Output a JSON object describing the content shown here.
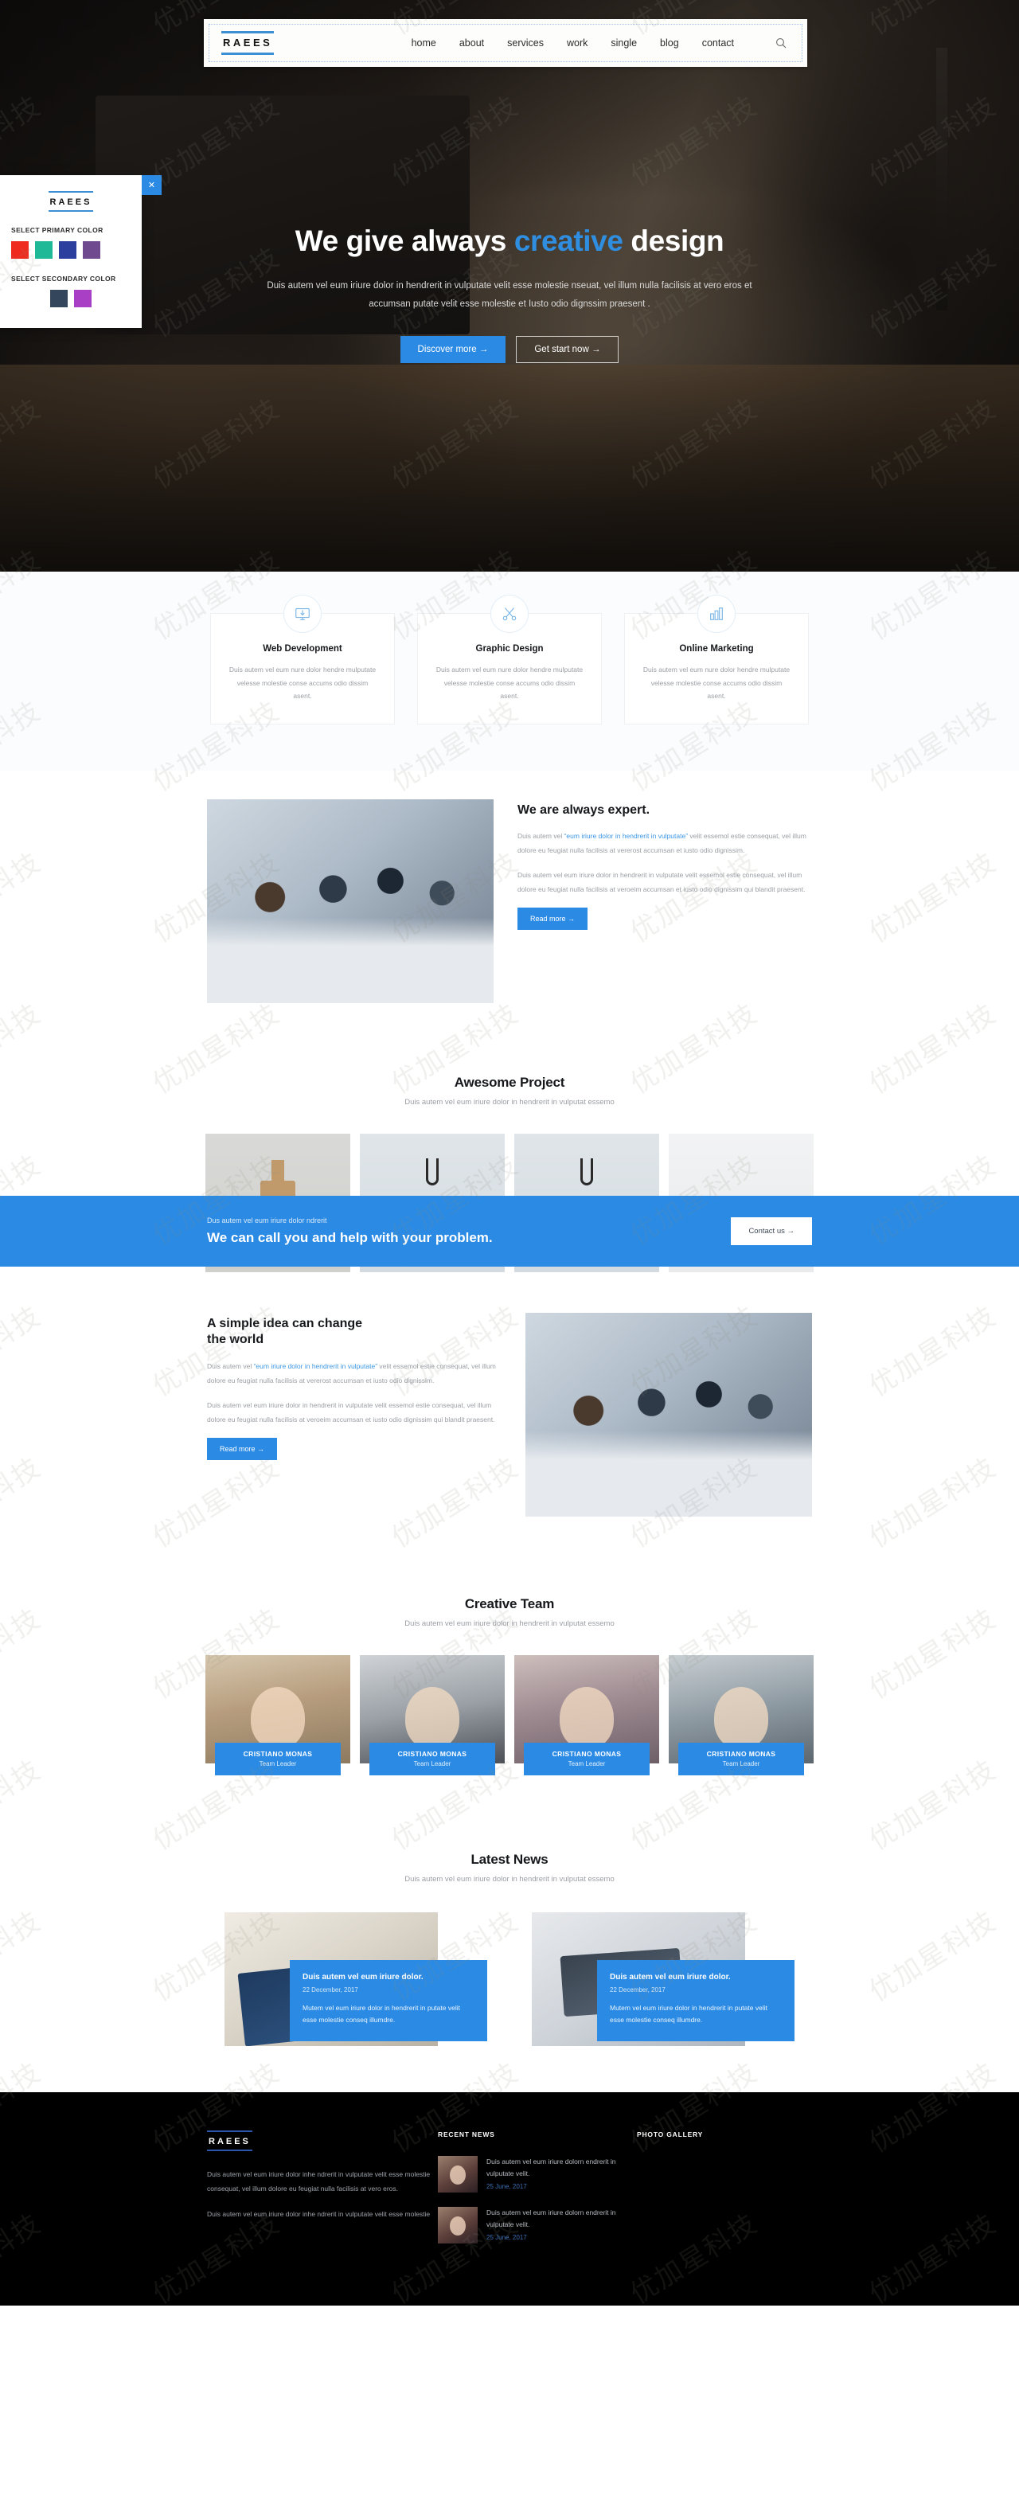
{
  "brand": {
    "name": "RAEES"
  },
  "nav": {
    "items": [
      {
        "label": "home"
      },
      {
        "label": "about"
      },
      {
        "label": "services"
      },
      {
        "label": "work"
      },
      {
        "label": "single"
      },
      {
        "label": "blog"
      },
      {
        "label": "contact"
      }
    ],
    "search_icon": "search-icon"
  },
  "hero": {
    "title_part1": "We give always ",
    "title_accent": "creative",
    "title_part2": " design",
    "subtitle": "Duis autem vel eum iriure dolor in hendrerit in vulputate velit esse molestie nseuat, vel illum nulla facilisis at vero eros et accumsan putate velit esse molestie et Iusto odio dignssim praesent .",
    "btn_primary": "Discover more  →",
    "btn_secondary": "Get start now  →"
  },
  "color_panel": {
    "logo": "RAEES",
    "primary_label": "SELECT PRIMARY COLOR",
    "secondary_label": "SELECT SECONDARY COLOR",
    "primary_colors": [
      "#ef2b20",
      "#1fb998",
      "#2c3f9e",
      "#6f4a8e"
    ],
    "secondary_colors": [
      "#33465c",
      "#a93fc5"
    ],
    "close_label": "✕"
  },
  "services": {
    "cards": [
      {
        "icon": "monitor-download-icon",
        "title": "Web Development",
        "desc": "Duis autem vel eum nure dolor hendre mulputate velesse molestie conse accums odio dissim asent."
      },
      {
        "icon": "scissors-icon",
        "title": "Graphic Design",
        "desc": "Duis autem vel eum nure dolor hendre mulputate velesse molestie conse accums odio dissim asent."
      },
      {
        "icon": "bar-chart-icon",
        "title": "Online Marketing",
        "desc": "Duis autem vel eum nure dolor hendre mulputate velesse molestie conse accums odio dissim asent."
      }
    ]
  },
  "expert": {
    "title": "We are always expert.",
    "p1_before": "Duis autem vel ",
    "p1_quote": "“eum iriure dolor in hendrerit in vulputate”",
    "p1_after": " velit essemol estie consequat, vel illum dolore eu feugiat nulla facilisis at vererost accumsan et iusto odio dignissim.",
    "p2": "Duis autem vel eum iriure dolor in hendrerit in vulputate velit essemol estie consequat, vel illum dolore eu feugiat nulla facilisis at veroeim accumsan et iusto odio dignissim qui blandit praesent.",
    "button": "Read more →"
  },
  "project": {
    "title": "Awesome Project",
    "subtitle": "Duis autem vel eum iriure dolor in hendrerit in vulputat essemo",
    "items": [
      {
        "name": "paper-tag-product"
      },
      {
        "name": "hook-pouch-product"
      },
      {
        "name": "hook-pouch-product-2"
      },
      {
        "name": "cutlery-product"
      }
    ]
  },
  "cta": {
    "small": "Dus autem vel eum iriure dolor ndrerit",
    "title": "We can call you and help with your problem.",
    "button": "Contact us  →"
  },
  "idea": {
    "title_line1": "A simple idea can change",
    "title_line2": "the world",
    "p1_before": "Duis autem vel ",
    "p1_quote": "“eum iriure dolor in hendrerit in vulputate”",
    "p1_after": " velit essemol estie consequat, vel illum dolore eu feugiat nulla facilisis at vererost accumsan et iusto odio dignissim.",
    "p2": "Duis autem vel eum iriure dolor in hendrerit in vulputate velit essemol estie consequat, vel illum dolore eu feugiat nulla facilisis at veroeim accumsan et iusto odio dignissim qui blandit praesent.",
    "button": "Read more →"
  },
  "team": {
    "title": "Creative Team",
    "subtitle": "Duis autem vel eum iriure dolor in hendrerit in vulputat essemo",
    "members": [
      {
        "name": "CRISTIANO MONAS",
        "role": "Team Leader"
      },
      {
        "name": "CRISTIANO MONAS",
        "role": "Team Leader"
      },
      {
        "name": "CRISTIANO MONAS",
        "role": "Team Leader"
      },
      {
        "name": "CRISTIANO MONAS",
        "role": "Team Leader"
      }
    ]
  },
  "news": {
    "title": "Latest News",
    "subtitle": "Duis autem vel eum iriure dolor in hendrerit in vulputat essemo",
    "posts": [
      {
        "title": "Duis autem vel eum iriure dolor.",
        "date": "22 December, 2017",
        "text": "Mutem vel eum iriure dolor in hendrerit in putate velit esse molestie conseq illumdre."
      },
      {
        "title": "Duis autem vel eum iriure dolor.",
        "date": "22 December, 2017",
        "text": "Mutem vel eum iriure dolor in hendrerit in putate velit esse molestie conseq illumdre."
      }
    ]
  },
  "footer": {
    "logo": "RAEES",
    "about_p1": "Duis autem vel eum iriure dolor inhe ndrerit in vulputate velit esse molestie consequat, vel illum dolore eu feugiat nulla facilisis at vero eros.",
    "about_p2": "Duis autem vel eum iriure dolor inhe ndrerit in vulputate velit esse molestie",
    "recent_news_head": "RECENT NEWS",
    "photo_gallery_head": "PHOTO GALLERY",
    "recent_news": [
      {
        "text": "Duis autem vel eum iriure dolorn endrerit in vulputate velit.",
        "date": "25 June, 2017"
      },
      {
        "text": "Duis autem vel eum iriure dolorn endrerit in vulputate velit.",
        "date": "25 June, 2017"
      }
    ]
  },
  "watermark": {
    "text": "优加星科技"
  }
}
